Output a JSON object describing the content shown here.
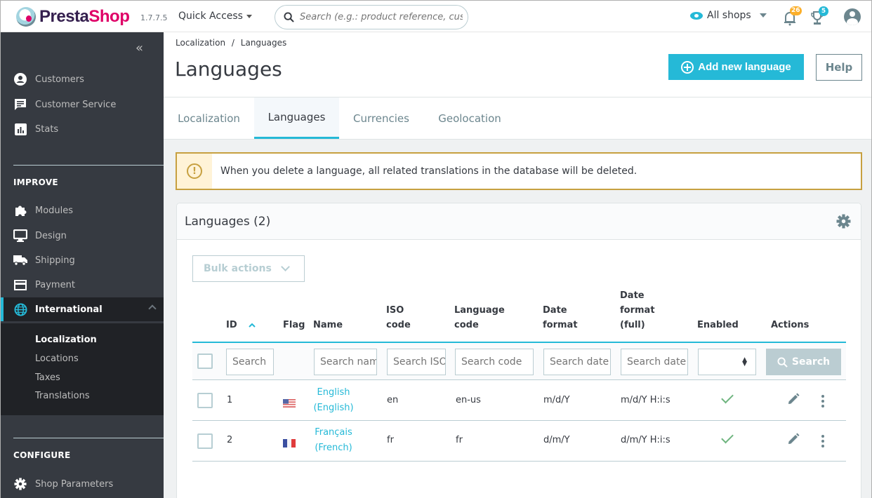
{
  "header": {
    "logo_part1": "Presta",
    "logo_part2": "Shop",
    "version": "1.7.7.5",
    "quick_access": "Quick Access",
    "search_placeholder": "Search (e.g.: product reference, customer name…)",
    "shop_selector": "All shops",
    "notifications_count": "26",
    "trophy_count": "5",
    "colors": {
      "accent": "#25b9d7",
      "notif_badge": "#fbaf2a",
      "trophy_badge": "#25b9d7"
    }
  },
  "sidebar": {
    "items_top": [
      {
        "label": "Customers",
        "icon": "user-circle-icon"
      },
      {
        "label": "Customer Service",
        "icon": "chat-icon"
      },
      {
        "label": "Stats",
        "icon": "stats-icon"
      }
    ],
    "section_improve": "IMPROVE",
    "items_improve": [
      {
        "label": "Modules",
        "icon": "puzzle-icon"
      },
      {
        "label": "Design",
        "icon": "monitor-icon"
      },
      {
        "label": "Shipping",
        "icon": "truck-icon"
      },
      {
        "label": "Payment",
        "icon": "card-icon"
      },
      {
        "label": "International",
        "icon": "globe-icon",
        "active": true
      }
    ],
    "sub_items": [
      {
        "label": "Localization",
        "active": true
      },
      {
        "label": "Locations"
      },
      {
        "label": "Taxes"
      },
      {
        "label": "Translations"
      }
    ],
    "section_configure": "CONFIGURE",
    "items_configure": [
      {
        "label": "Shop Parameters",
        "icon": "gear-icon"
      }
    ]
  },
  "page": {
    "breadcrumb": [
      "Localization",
      "Languages"
    ],
    "breadcrumb_sep": "/",
    "title": "Languages",
    "add_button": "Add new language",
    "help_button": "Help",
    "tabs": [
      {
        "label": "Localization"
      },
      {
        "label": "Languages",
        "active": true
      },
      {
        "label": "Currencies"
      },
      {
        "label": "Geolocation"
      }
    ]
  },
  "alert": {
    "icon": "!",
    "text": "When you delete a language, all related translations in the database will be deleted."
  },
  "panel": {
    "title": "Languages (2)",
    "bulk_actions": "Bulk actions",
    "columns": {
      "id": "ID",
      "flag": "Flag",
      "name": "Name",
      "iso_1": "ISO",
      "iso_2": "code",
      "lang_1": "Language",
      "lang_2": "code",
      "date_1": "Date",
      "date_2": "format",
      "datefull_1": "Date",
      "datefull_2": "format",
      "datefull_3": "(full)",
      "enabled": "Enabled",
      "actions": "Actions"
    },
    "filters": {
      "id": "Search",
      "name": "Search name",
      "iso": "Search ISO code",
      "lang": "Search code",
      "date": "Search date format",
      "datefull": "Search date format",
      "enabled_value": "",
      "search_button": "Search"
    },
    "rows": [
      {
        "id": "1",
        "flag": "us",
        "name_1": "English",
        "name_2": "(English)",
        "iso": "en",
        "lang": "en-us",
        "date": "m/d/Y",
        "datefull": "m/d/Y H:i:s",
        "enabled": true
      },
      {
        "id": "2",
        "flag": "fr",
        "name_1": "Français",
        "name_2": "(French)",
        "iso": "fr",
        "lang": "fr",
        "date": "d/m/Y",
        "datefull": "d/m/Y H:i:s",
        "enabled": true
      }
    ]
  }
}
